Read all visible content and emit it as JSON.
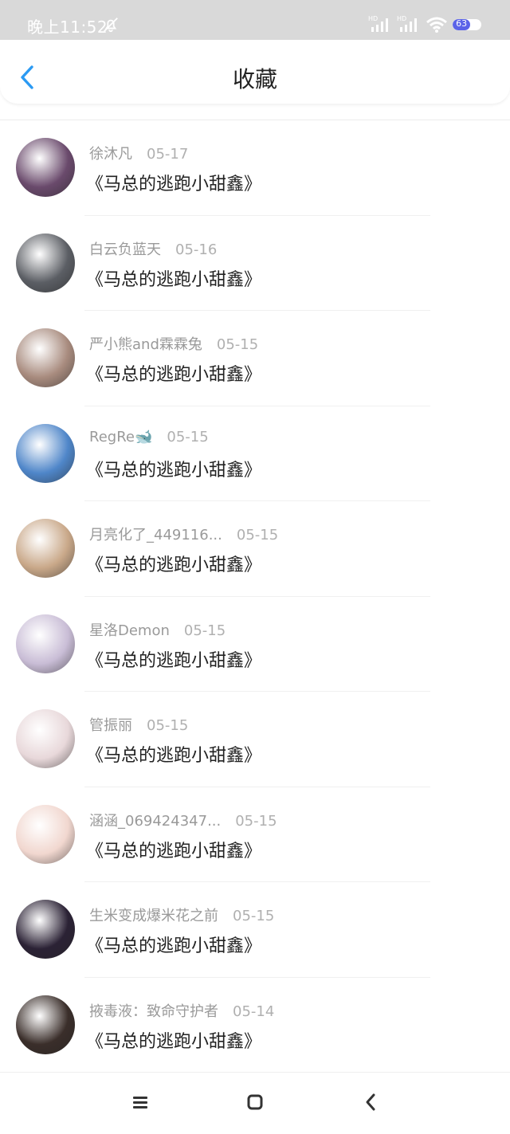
{
  "status_bar": {
    "time": "晚上11:52",
    "battery": "63",
    "icons": [
      "bell-off-icon",
      "signal-hd-icon",
      "signal-hd-icon",
      "wifi-icon",
      "battery-icon"
    ]
  },
  "header": {
    "title": "收藏",
    "back_icon": "chevron-left-icon"
  },
  "items": [
    {
      "user": "徐沐凡",
      "date": "05-17",
      "book": "《马总的逃跑小甜鑫》",
      "avatar_color": "#6a4a6c"
    },
    {
      "user": "白云负蓝天",
      "date": "05-16",
      "book": "《马总的逃跑小甜鑫》",
      "avatar_color": "#5b5e64"
    },
    {
      "user": "严小熊and霖霖兔",
      "date": "05-15",
      "book": "《马总的逃跑小甜鑫》",
      "avatar_color": "#a88b7e"
    },
    {
      "user": "RegRe🐋",
      "date": "05-15",
      "book": "《马总的逃跑小甜鑫》",
      "avatar_color": "#4f86c9"
    },
    {
      "user": "月亮化了_449116...",
      "date": "05-15",
      "book": "《马总的逃跑小甜鑫》",
      "avatar_color": "#c9a889"
    },
    {
      "user": "星洛Demon",
      "date": "05-15",
      "book": "《马总的逃跑小甜鑫》",
      "avatar_color": "#c9bdd6"
    },
    {
      "user": "管振丽",
      "date": "05-15",
      "book": "《马总的逃跑小甜鑫》",
      "avatar_color": "#e8d8da"
    },
    {
      "user": "涵涵_069424347...",
      "date": "05-15",
      "book": "《马总的逃跑小甜鑫》",
      "avatar_color": "#f1d7cf"
    },
    {
      "user": "生米变成爆米花之前",
      "date": "05-15",
      "book": "《马总的逃跑小甜鑫》",
      "avatar_color": "#2b2235"
    },
    {
      "user": "掖毒液：致命守护者",
      "date": "05-14",
      "book": "《马总的逃跑小甜鑫》",
      "avatar_color": "#3a2e2a"
    }
  ],
  "nav_bar": {
    "icons": [
      "menu-icon",
      "home-square-icon",
      "back-arrow-icon"
    ]
  }
}
